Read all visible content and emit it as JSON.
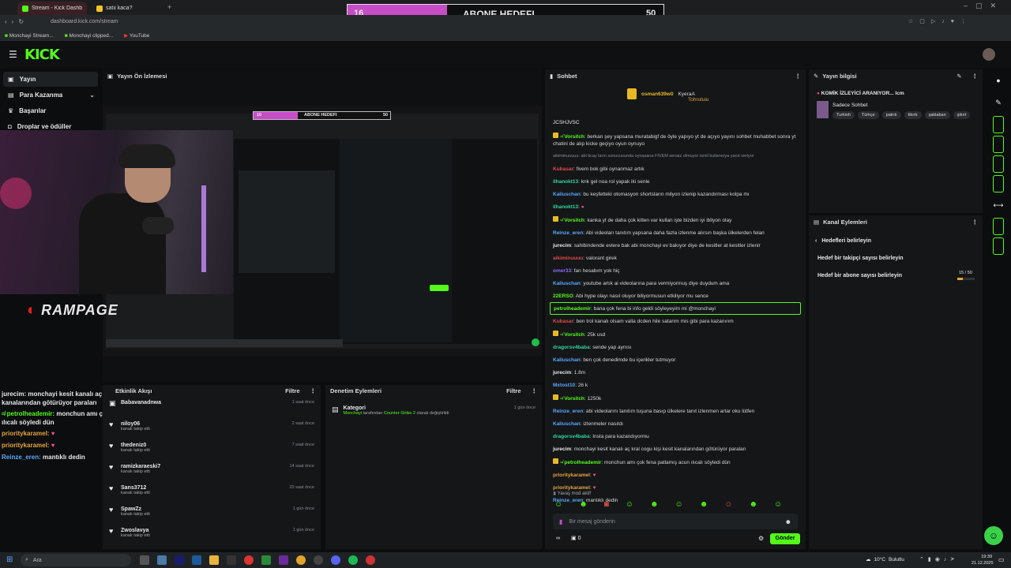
{
  "browser": {
    "tabs": [
      {
        "label": "Stream - Kick Dashboard"
      },
      {
        "label": "satıi kaca?"
      }
    ],
    "url": "dashboard.kick.com/stream",
    "bookmarks": [
      "Monchayi Stream...",
      "Monchayi clipped...",
      "YouTube"
    ]
  },
  "goal_overlay": {
    "current": "16",
    "title": "ABONE HEDEFI",
    "target": "50",
    "progress": 0.32
  },
  "nav": {
    "logo": "KICK",
    "items": [
      {
        "label": "Yayın"
      },
      {
        "label": "Para Kazanma"
      },
      {
        "label": "Başarılar"
      },
      {
        "label": "Droplar ve ödüller"
      }
    ]
  },
  "preview": {
    "title": "Yayın Ön İzlemesi",
    "brand": "RAMPAGE",
    "mini_goal": {
      "current": "16",
      "title": "ABONE HEDEFI",
      "target": "50"
    }
  },
  "overlay_chat": [
    {
      "user": "jurecim:",
      "text": "monchayi kesit kanalı aç kral cogu kişi kesit kanalarından götürüyor paraları",
      "color": "#e8e8e8"
    },
    {
      "user": "petrolheademir:",
      "text": "monchun amı çok fena patlamış acun ılıcalı söyledi dün",
      "color": "#53fc18"
    },
    {
      "user": "prioritykaramel:",
      "text": "",
      "color": "#e9a23b"
    },
    {
      "user": "prioritykaramel:",
      "text": "",
      "color": "#e9a23b"
    },
    {
      "user": "Reinze_eren:",
      "text": "mantıklı dedin",
      "color": "#5aa9ff"
    }
  ],
  "activity": {
    "title": "Etkinlik Akışı",
    "filter": "Filtre",
    "items": [
      {
        "name": "Babavanadnwa",
        "sub": "",
        "time": "1 saat önce"
      },
      {
        "name": "niloy06",
        "sub": "kanalı takip etti",
        "time": "2 saat önce"
      },
      {
        "name": "thedeniz0",
        "sub": "kanalı takip etti",
        "time": "7 saat önce"
      },
      {
        "name": "ramizkaraeski7",
        "sub": "kanalı takip etti",
        "time": "14 saat önce"
      },
      {
        "name": "Sans3712",
        "sub": "kanalı takip etti",
        "time": "23 saat önce"
      },
      {
        "name": "SpawZz",
        "sub": "kanalı takip etti",
        "time": "1 gün önce"
      },
      {
        "name": "Zwoslavya",
        "sub": "kanalı takip etti",
        "time": "1 gün önce"
      }
    ]
  },
  "audit": {
    "title": "Denetim Eylemleri",
    "filter": "Filtre",
    "item": {
      "title": "Kategori",
      "actor": "Monchayi",
      "mid": "tarafından",
      "game": "Counter-Strike 2",
      "suffix": "olarak değiştirildi",
      "time": "1 gün önce"
    }
  },
  "chat": {
    "title": "Sohbet",
    "top": [
      {
        "name": "osman639w0"
      },
      {
        "name": "KyeraA"
      },
      {
        "name": "Tohruluiu"
      }
    ],
    "header_line": "JCSHJVSC",
    "messages": [
      {
        "user": "Vorsitch",
        "color": "#53fc18",
        "text": "berkan şey yapsana muratabigf de öyle yapıyo yt de açıyo yayını sohbet muhabbet sonra yt chatini de alıp kicke geçiyo oyun oynuyo",
        "badge": true
      },
      {
        "user": "",
        "color": "#8a8f93",
        "text": "aikiminuuuuu: abi ticay ların sonucusunda oynasana FIVEM senaiz olmuyor ismil kullanıoya yanıt veriyor",
        "badge": false
      },
      {
        "user": "Kubasar",
        "color": "#e34b4b",
        "text": "fivem bok gibi oynanmaz artık",
        "badge": false
      },
      {
        "user": "ilhanokt13",
        "color": "#2fd6a0",
        "text": "knk gel noa rol yapak iki senle",
        "badge": false
      },
      {
        "user": "Kaliuschan",
        "color": "#5aa9ff",
        "text": "bu keşfetteki otomasyon shortsların milyon izlenip kazandırması kolpa mı",
        "badge": false
      },
      {
        "user": "ilhanokt13",
        "color": "#2fd6a0",
        "text": "",
        "badge": false
      },
      {
        "user": "Vorsitch",
        "color": "#53fc18",
        "text": "kanka yt de daha çok kitlen var kullan işte bizden iyi ibliyon olay",
        "badge": true
      },
      {
        "user": "Reinze_eren",
        "color": "#5aa9ff",
        "text": "Abi videoları tanıtım yapsana daha fazla izlenme alırsın başka ülkelerden felan",
        "badge": false
      },
      {
        "user": "jurecim",
        "color": "#e8e8e8",
        "text": "sahibindende evlere bak abi monchayi ev bakıyor diye de kesitler at kesitler izlenir",
        "badge": false
      },
      {
        "user": "aikiminuuuu",
        "color": "#e34b4b",
        "text": "valorant girek",
        "badge": false
      },
      {
        "user": "omer33",
        "color": "#8d6bff",
        "text": "fan hesabım yok hiç",
        "badge": false
      },
      {
        "user": "Kaliuschan",
        "color": "#5aa9ff",
        "text": "youtube artık ai videolarına para vermiyormuş diye duydum ama",
        "badge": false
      },
      {
        "user": "22ERSO",
        "color": "#53fc18",
        "text": "Abi hype olayı nasıl oluyor biliyormusun etkiliyor mu sence",
        "badge": false
      },
      {
        "user": "petrolheademir",
        "color": "#53fc18",
        "text": "bana çok fena bi info geldi söyleyeyim mi @monchayi",
        "badge": false,
        "highlight": true
      },
      {
        "user": "Kubasar",
        "color": "#e34b4b",
        "text": "ben trol kanalı olsam valla dcden hile satarım mis gibi para kazanırım",
        "badge": false
      },
      {
        "user": "Vorsitch",
        "color": "#53fc18",
        "text": "25k usd",
        "badge": true
      },
      {
        "user": "dragorsv4baba",
        "color": "#2fd6a0",
        "text": "sende yap aynısı",
        "badge": false
      },
      {
        "user": "Kaliuschan",
        "color": "#5aa9ff",
        "text": "ben çok denedimde bu içerikler tutmuyor",
        "badge": false
      },
      {
        "user": "jurecim",
        "color": "#e8e8e8",
        "text": "1.8m",
        "badge": false
      },
      {
        "user": "Mxtost10",
        "color": "#5aa9ff",
        "text": "26 k",
        "badge": false
      },
      {
        "user": "Vorsitch",
        "color": "#53fc18",
        "text": "1250k",
        "badge": true
      },
      {
        "user": "Reinze_eren",
        "color": "#5aa9ff",
        "text": "abi videolarını tanıtım tuşuna basıp ülkelere tanıt izlenmen artar oku lütfen",
        "badge": false
      },
      {
        "user": "Kaliuschan",
        "color": "#5aa9ff",
        "text": "izlenmeler nasıldı",
        "badge": false
      },
      {
        "user": "dragorsv4baba",
        "color": "#2fd6a0",
        "text": "Insta para kazandıyormu",
        "badge": false
      },
      {
        "user": "jurecim",
        "color": "#e8e8e8",
        "text": "monchayi kesit kanalı aç kral cogu kişi kesit kanalarından götürüyor paraları",
        "badge": false
      },
      {
        "user": "petrolheademir",
        "color": "#53fc18",
        "text": "monchun amı çok fena patlamış acun ılıcalı söyledi dün",
        "badge": true
      },
      {
        "user": "prioritykaramel",
        "color": "#e9a23b",
        "text": "",
        "badge": false
      },
      {
        "user": "prioritykaramel",
        "color": "#e9a23b",
        "text": "",
        "badge": false
      },
      {
        "user": "Reinze_eren",
        "color": "#5aa9ff",
        "text": "mantıklı dedin",
        "badge": false
      }
    ],
    "slow_mode": "Yavaş mod aktif",
    "input_placeholder": "Bir mesaj gönderin",
    "send_label": "Gönder",
    "counter": "0"
  },
  "stream_info": {
    "title": "Yayın bilgisi",
    "stream_title": "KOMİK İZLEYİCİ ARANIYOR... lcm",
    "category": "Sadece Sohbet",
    "tags": [
      "Turkish",
      "Türkçe",
      "patrıtı",
      "tikırtı",
      "şaklaban",
      "şikırt"
    ]
  },
  "channel_actions": {
    "title": "Kanal Eylemleri",
    "back": "Hedefleri belirleyin",
    "items": [
      {
        "label": "Hedef bir takipçi sayısı belirleyin"
      },
      {
        "label": "Hedef bir abone sayısı belirleyin",
        "value": "15 / 50",
        "progress": 0.3
      }
    ]
  },
  "taskbar": {
    "search": "Ara",
    "weather": "10°C",
    "weather_desc": "Bulutlu",
    "time": "19:39",
    "date": "21.12.2025"
  }
}
